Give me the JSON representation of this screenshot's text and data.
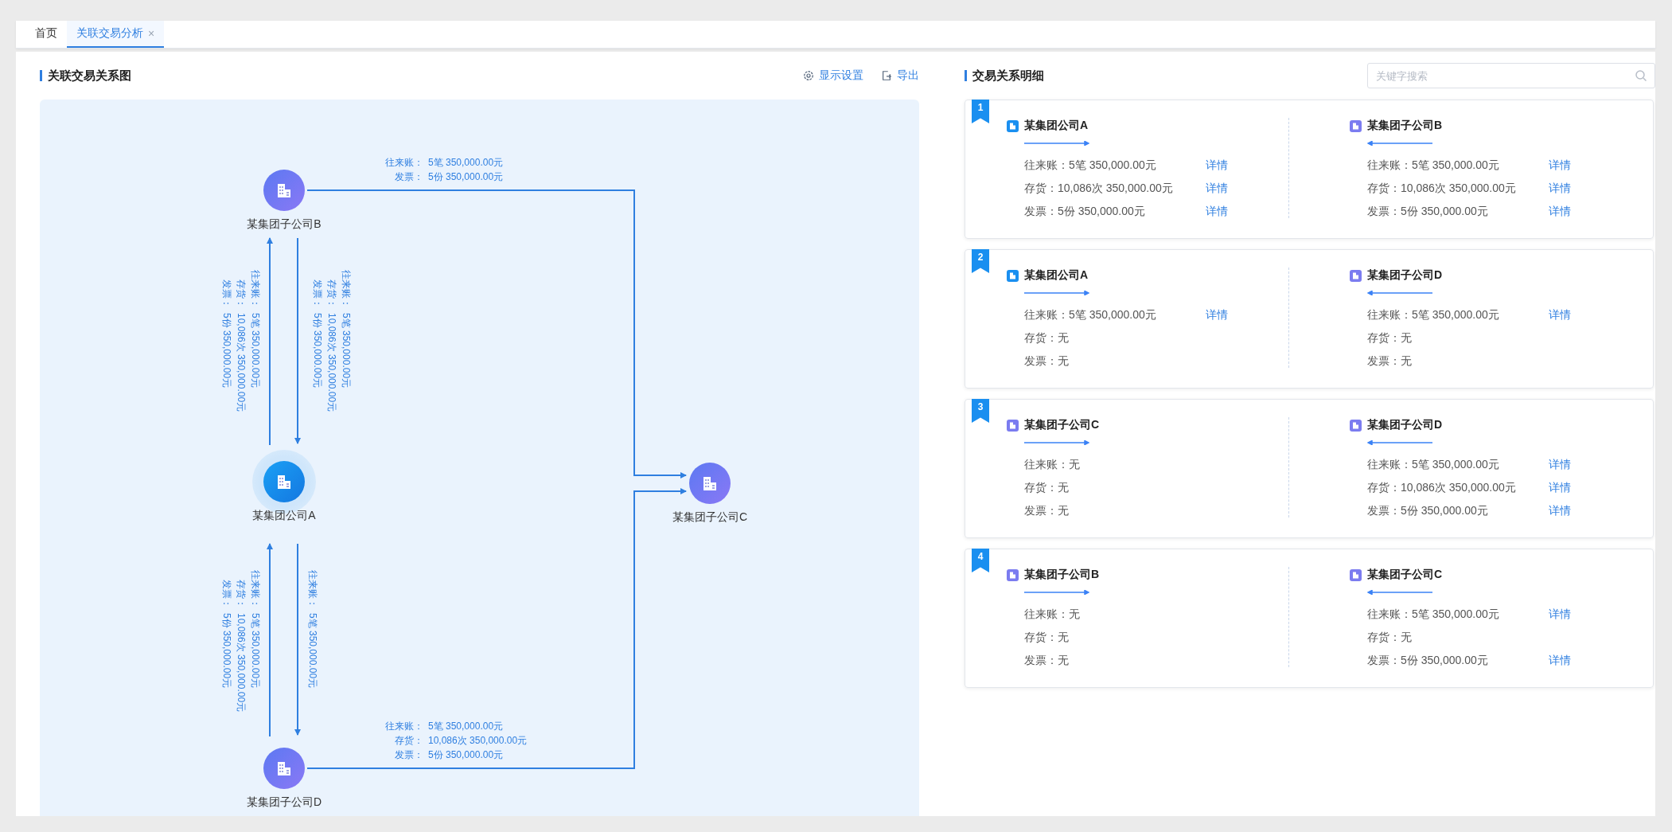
{
  "tabs": [
    {
      "label": "首页",
      "selected": false
    },
    {
      "label": "关联交易分析",
      "selected": true,
      "close": "×"
    }
  ],
  "graph_panel": {
    "title": "关联交易关系图",
    "actions": [
      {
        "kind": "settings",
        "label": "显示设置"
      },
      {
        "kind": "export",
        "label": "导出"
      }
    ],
    "nodes": [
      {
        "name": "某集团子公司B",
        "kind": "sub"
      },
      {
        "name": "某集团公司A",
        "kind": "main"
      },
      {
        "name": "某集团子公司D",
        "kind": "sub"
      },
      {
        "name": "某集团子公司C",
        "kind": "sub"
      }
    ],
    "edges": [
      {
        "lines": [
          {
            "label": "往来账：",
            "value": "5笔  350,000.00元"
          },
          {
            "label": "发票：",
            "value": "5份  350,000.00元"
          }
        ]
      },
      {
        "lines": [
          {
            "label": "往来账：",
            "value": "5笔  350,000.00元"
          },
          {
            "label": "存货：",
            "value": "10,086次  350,000.00元"
          },
          {
            "label": "发票：",
            "value": "5份  350,000.00元"
          }
        ]
      },
      {
        "lines": [
          {
            "label": "往来账：",
            "value": "5笔  350,000.00元"
          },
          {
            "label": "存货：",
            "value": "10,086次  350,000.00元"
          },
          {
            "label": "发票：",
            "value": "5份  350,000.00元"
          }
        ]
      },
      {
        "lines": [
          {
            "label": "往来账：",
            "value": "5笔  350,000.00元"
          },
          {
            "label": "存货：",
            "value": "10,086次  350,000.00元"
          },
          {
            "label": "发票：",
            "value": "5份  350,000.00元"
          }
        ]
      },
      {
        "lines": [
          {
            "label": "往来账：",
            "value": "5笔  350,000.00元"
          }
        ]
      },
      {
        "lines": [
          {
            "label": "往来账：",
            "value": "5笔  350,000.00元"
          },
          {
            "label": "存货：",
            "value": "10,086次  350,000.00元"
          },
          {
            "label": "发票：",
            "value": "5份  350,000.00元"
          }
        ]
      }
    ]
  },
  "detail_panel": {
    "title": "交易关系明细",
    "search": {
      "placeholder": "关键字搜索"
    },
    "cards": [
      {
        "index": "1",
        "parties": [
          {
            "name": "某集团公司A",
            "kind": "main",
            "rows": [
              {
                "text": "往来账：5笔 350,000.00元",
                "link": "详情"
              },
              {
                "text": "存货：10,086次 350,000.00元",
                "link": "详情"
              },
              {
                "text": "发票：5份 350,000.00元",
                "link": "详情"
              }
            ]
          },
          {
            "name": "某集团子公司B",
            "kind": "sub",
            "rows": [
              {
                "text": "往来账：5笔 350,000.00元",
                "link": "详情"
              },
              {
                "text": "存货：10,086次 350,000.00元",
                "link": "详情"
              },
              {
                "text": "发票：5份 350,000.00元",
                "link": "详情"
              }
            ]
          }
        ]
      },
      {
        "index": "2",
        "parties": [
          {
            "name": "某集团公司A",
            "kind": "main",
            "rows": [
              {
                "text": "往来账：5笔 350,000.00元",
                "link": "详情"
              },
              {
                "text": "存货：无"
              },
              {
                "text": "发票：无"
              }
            ]
          },
          {
            "name": "某集团子公司D",
            "kind": "sub",
            "rows": [
              {
                "text": "往来账：5笔 350,000.00元",
                "link": "详情"
              },
              {
                "text": "存货：无"
              },
              {
                "text": "发票：无"
              }
            ]
          }
        ]
      },
      {
        "index": "3",
        "parties": [
          {
            "name": "某集团子公司C",
            "kind": "sub",
            "rows": [
              {
                "text": "往来账：无"
              },
              {
                "text": "存货：无"
              },
              {
                "text": "发票：无"
              }
            ]
          },
          {
            "name": "某集团子公司D",
            "kind": "sub",
            "rows": [
              {
                "text": "往来账：5笔 350,000.00元",
                "link": "详情"
              },
              {
                "text": "存货：10,086次 350,000.00元",
                "link": "详情"
              },
              {
                "text": "发票：5份 350,000.00元",
                "link": "详情"
              }
            ]
          }
        ]
      },
      {
        "index": "4",
        "parties": [
          {
            "name": "某集团子公司B",
            "kind": "sub",
            "rows": [
              {
                "text": "往来账：无"
              },
              {
                "text": "存货：无"
              },
              {
                "text": "发票：无"
              }
            ]
          },
          {
            "name": "某集团子公司C",
            "kind": "sub",
            "rows": [
              {
                "text": "往来账：5笔 350,000.00元",
                "link": "详情"
              },
              {
                "text": "存货：无"
              },
              {
                "text": "发票：5份 350,000.00元",
                "link": "详情"
              }
            ]
          }
        ]
      }
    ]
  }
}
